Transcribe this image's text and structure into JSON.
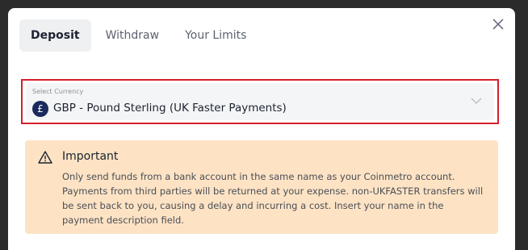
{
  "tabs": [
    {
      "label": "Deposit",
      "active": true
    },
    {
      "label": "Withdraw",
      "active": false
    },
    {
      "label": "Your Limits",
      "active": false
    }
  ],
  "close_icon": "close-icon",
  "currency_select": {
    "label": "Select Currency",
    "value": "GBP - Pound Sterling (UK Faster Payments)",
    "flag_symbol": "£",
    "highlight_color": "#d51f2b"
  },
  "notice": {
    "icon": "warning-icon",
    "title": "Important",
    "body": "Only send funds from a bank account in the same name as your Coinmetro account. Payments from third parties will be returned at your expense. non-UKFASTER transfers will be sent back to you, causing a delay and incurring a cost. Insert your name in the payment description field.",
    "background": "#fde3c4"
  }
}
